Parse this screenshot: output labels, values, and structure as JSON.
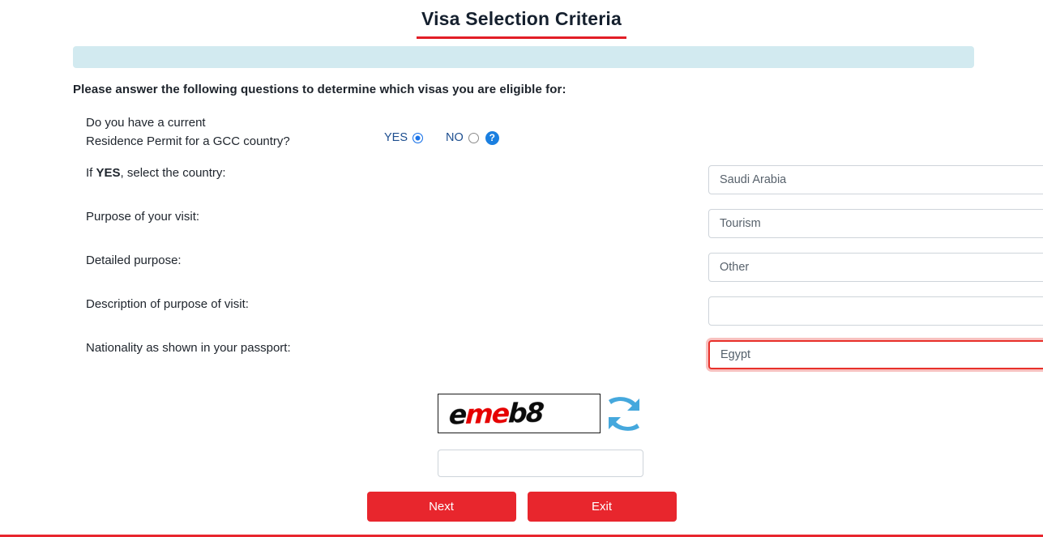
{
  "page": {
    "title": "Visa Selection Criteria",
    "intro": "Please answer the following questions to determine which visas you are eligible for:",
    "notice_bar_text": "",
    "accent_red": "#e8262d",
    "info_bar_color": "#d2eaf0",
    "title_underline_color": "#e21e26"
  },
  "questions": {
    "residence_permit": {
      "label_line1": "Do you have a current",
      "label_line2": "Residence Permit for a GCC country?",
      "yes_label": "YES",
      "no_label": "NO",
      "selected": "YES",
      "help_glyph": "?"
    },
    "country": {
      "label_prefix": "If ",
      "label_bold": "YES",
      "label_suffix": ", select the country:",
      "value": "Saudi Arabia"
    },
    "purpose": {
      "label": "Purpose of your visit:",
      "value": "Tourism"
    },
    "detailed_purpose": {
      "label": "Detailed purpose:",
      "value": "Other"
    },
    "description": {
      "label": "Description of purpose of visit:",
      "value": "",
      "placeholder": ""
    },
    "nationality": {
      "label": "Nationality as shown in your passport:",
      "value": "Egypt",
      "invalid": true,
      "error_border_color": "#e8312b"
    }
  },
  "captcha": {
    "part1": "e",
    "part2": "me",
    "part3": "b8",
    "full_text": "emeb8",
    "part1_color": "#0b0b0b",
    "part2_color": "#e60000",
    "part3_color": "#0b0b0b",
    "refresh_icon": "refresh-icon",
    "refresh_color": "#45a8dd",
    "input_value": "",
    "input_placeholder": ""
  },
  "buttons": {
    "next_label": "Next",
    "exit_label": "Exit"
  }
}
